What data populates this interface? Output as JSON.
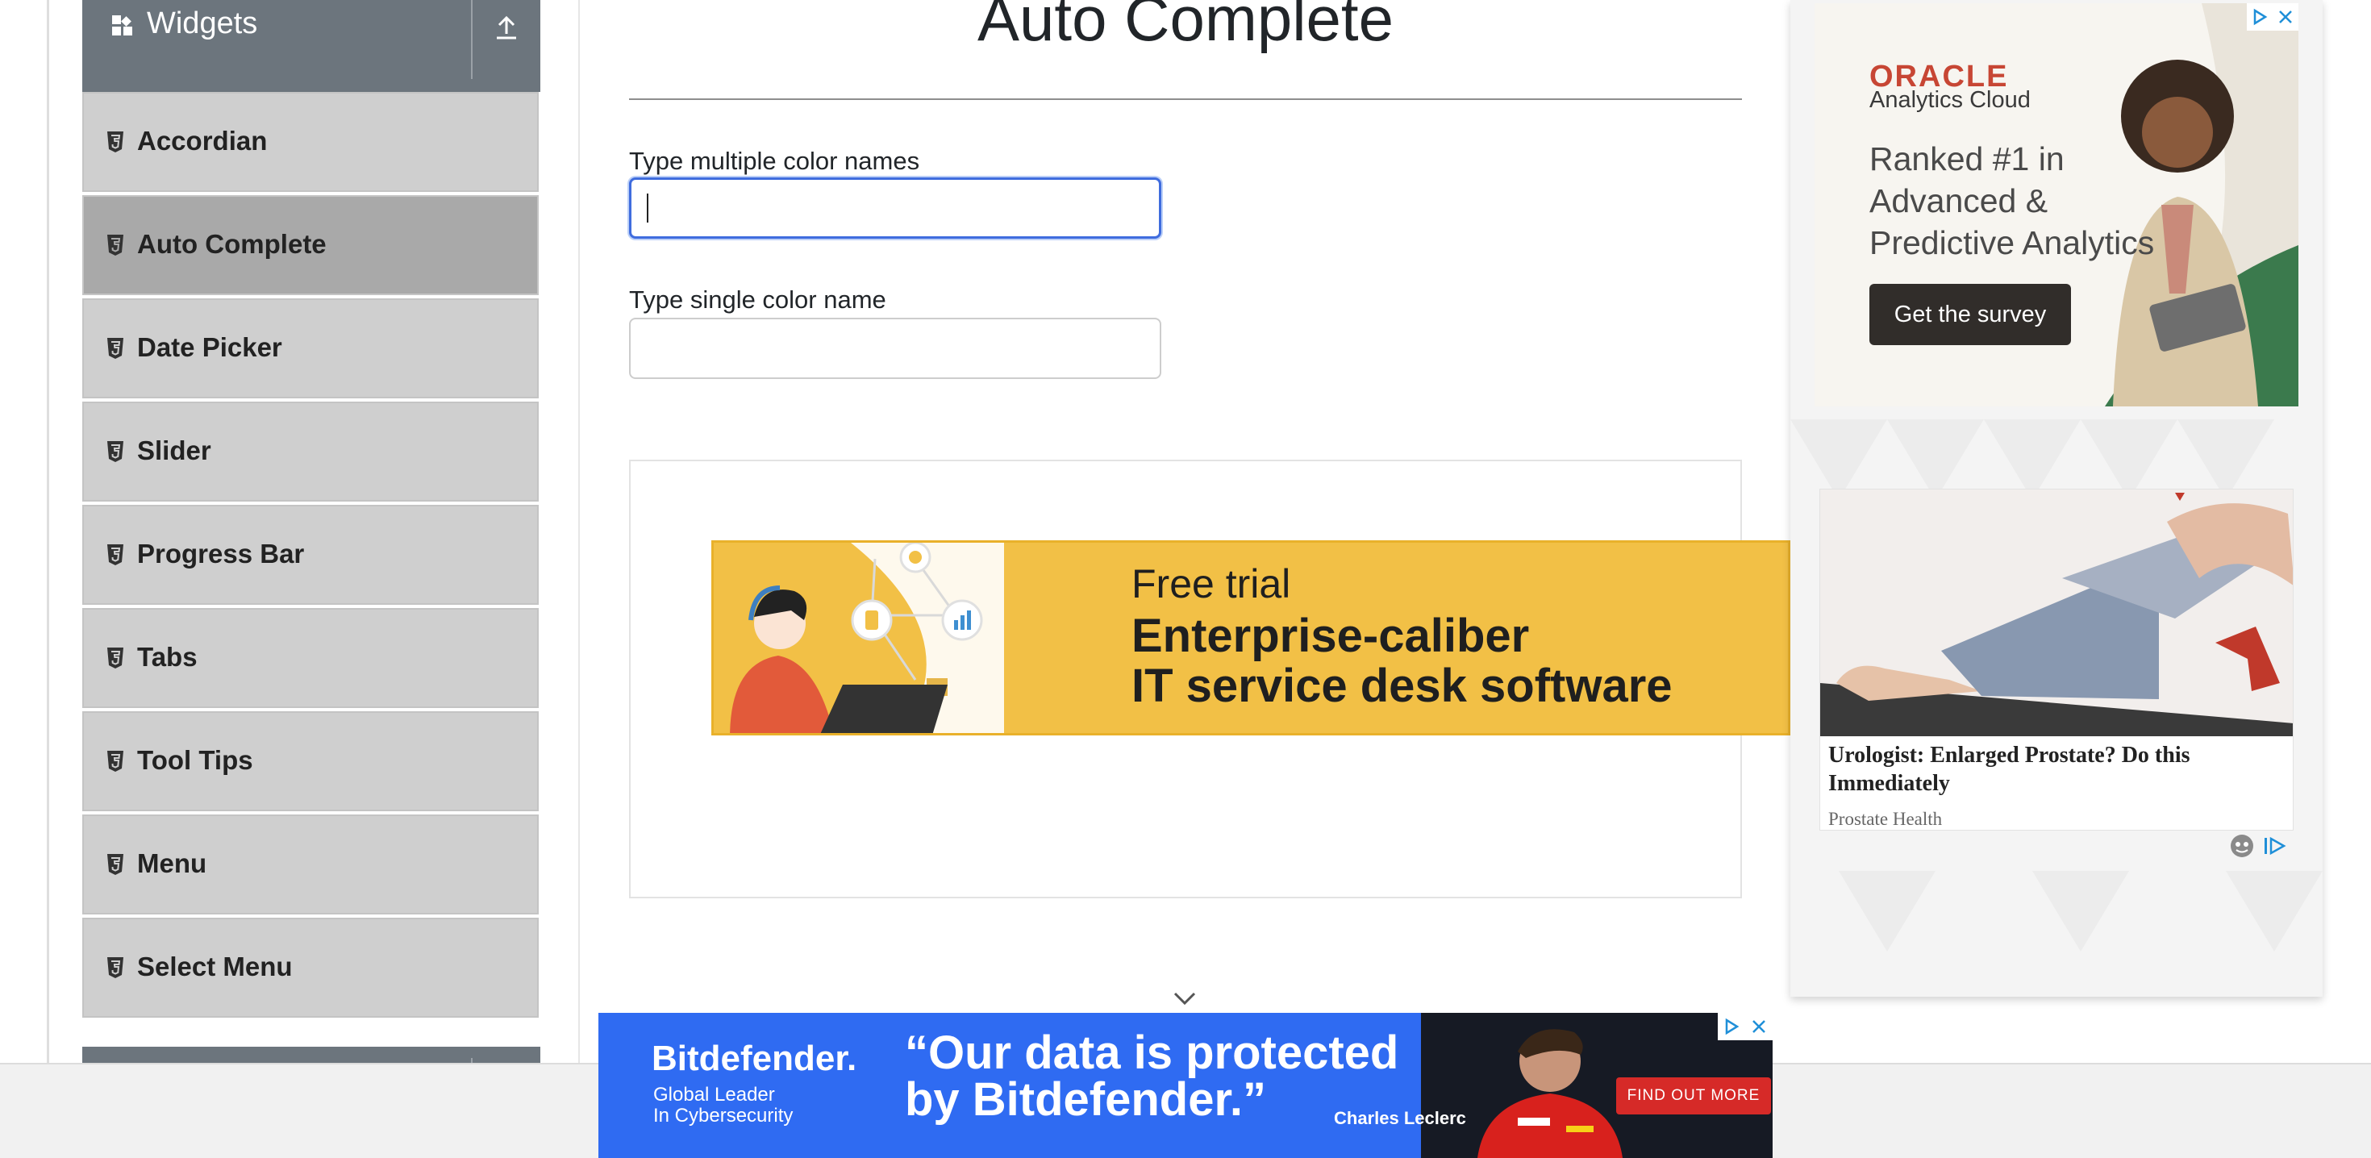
{
  "sidebar": {
    "group_title": "Widgets",
    "items": [
      {
        "label": "Accordian",
        "active": false
      },
      {
        "label": "Auto Complete",
        "active": true
      },
      {
        "label": "Date Picker",
        "active": false
      },
      {
        "label": "Slider",
        "active": false
      },
      {
        "label": "Progress Bar",
        "active": false
      },
      {
        "label": "Tabs",
        "active": false
      },
      {
        "label": "Tool Tips",
        "active": false
      },
      {
        "label": "Menu",
        "active": false
      },
      {
        "label": "Select Menu",
        "active": false
      }
    ]
  },
  "main": {
    "title": "Auto Complete",
    "fields": [
      {
        "label": "Type multiple color names",
        "value": ""
      },
      {
        "label": "Type single color name",
        "value": ""
      }
    ]
  },
  "ads": {
    "banner": {
      "line1": "Free trial",
      "line2": "Enterprise-caliber",
      "line3": "IT service desk software"
    },
    "oracle": {
      "logo": "ORACLE",
      "subtitle": "Analytics Cloud",
      "headline": [
        "Ranked #1 in",
        "Advanced &",
        "Predictive Analytics"
      ],
      "cta": "Get the survey"
    },
    "health": {
      "title": "Urologist: Enlarged Prostate? Do this Immediately",
      "source": "Prostate Health"
    },
    "bitdefender": {
      "brand": "Bitdefender.",
      "tagline": [
        "Global Leader",
        "In Cybersecurity"
      ],
      "quote": [
        "“Our data is protected",
        "by Bitdefender.”"
      ],
      "person": "Charles Leclerc",
      "cta": "FIND OUT MORE"
    }
  },
  "colors": {
    "sidebar_header": "#6c757d",
    "menu_item": "#cfcfcf",
    "menu_item_active": "#a9a9a9",
    "focus_border": "#3f6cde",
    "oracle_red": "#c74634",
    "bitdefender_blue": "#2f6bf2"
  },
  "icons": {
    "group": "widgets-icon",
    "collapse": "upload-icon",
    "item": "html5-icon",
    "scroll": "chevron-down-icon"
  }
}
